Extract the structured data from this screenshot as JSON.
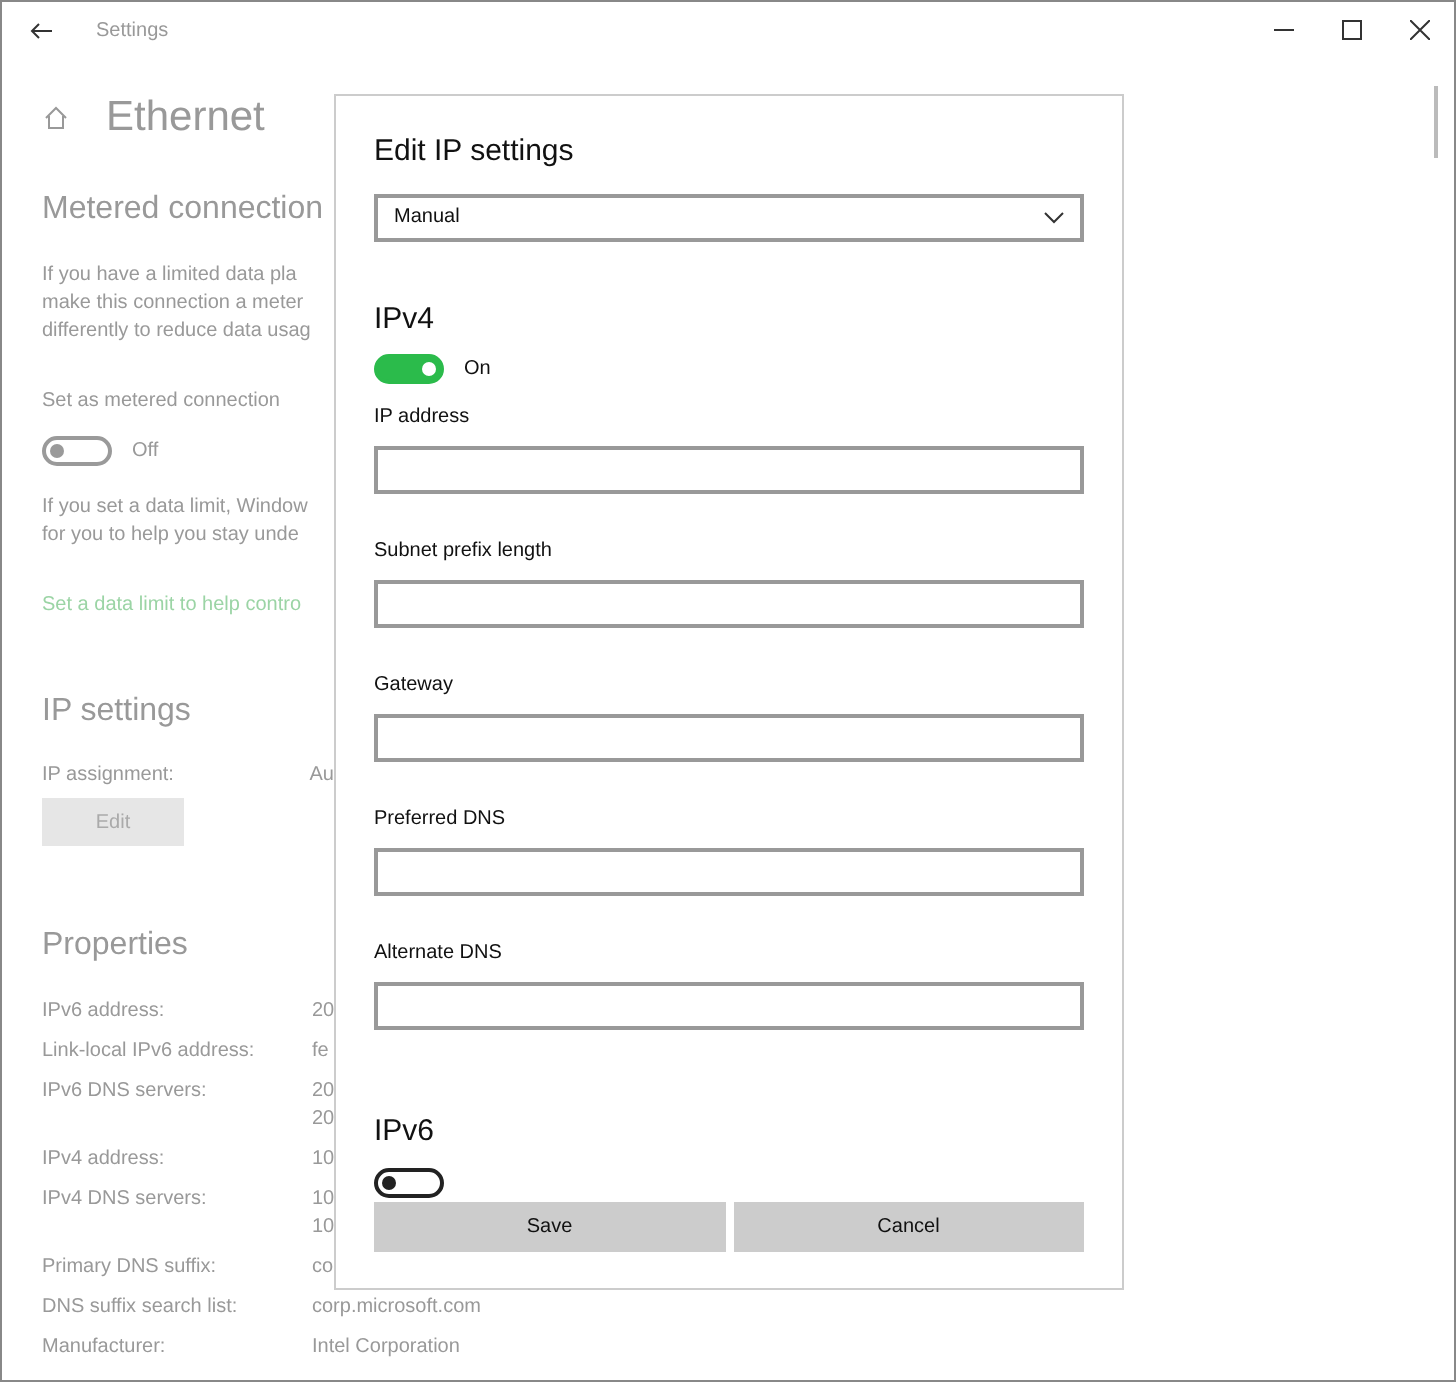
{
  "window": {
    "title": "Settings"
  },
  "page": {
    "title": "Ethernet"
  },
  "metered": {
    "heading": "Metered connection",
    "description": [
      "If you have a limited data pla",
      "make this connection a meter",
      "differently to reduce data usag"
    ],
    "toggle_label": "Set as metered connection",
    "on": false,
    "state_text": "Off",
    "limit_text": [
      "If you set a data limit, Window",
      "for you to help you stay unde"
    ],
    "link": "Set a data limit to help contro"
  },
  "ip_settings": {
    "heading": "IP settings",
    "label": "IP assignment:",
    "value": "Au",
    "button": "Edit"
  },
  "properties": {
    "heading": "Properties",
    "rows": [
      {
        "label": "IPv6 address:",
        "values": [
          "20"
        ]
      },
      {
        "label": "Link-local IPv6 address:",
        "values": [
          "fe"
        ]
      },
      {
        "label": "IPv6 DNS servers:",
        "values": [
          "20",
          "20"
        ]
      },
      {
        "label": "IPv4 address:",
        "values": [
          "10"
        ]
      },
      {
        "label": "IPv4 DNS servers:",
        "values": [
          "10",
          "10"
        ]
      },
      {
        "label": "Primary DNS suffix:",
        "values": [
          "co"
        ]
      },
      {
        "label": "DNS suffix search list:",
        "values": [
          "corp.microsoft.com"
        ]
      },
      {
        "label": "Manufacturer:",
        "values": [
          "Intel Corporation"
        ]
      }
    ]
  },
  "dialog": {
    "title": "Edit IP settings",
    "dropdown": "Manual",
    "ipv4": {
      "heading": "IPv4",
      "on": true,
      "state_text": "On",
      "fields": [
        {
          "label": "IP address"
        },
        {
          "label": "Subnet prefix length"
        },
        {
          "label": "Gateway"
        },
        {
          "label": "Preferred DNS"
        },
        {
          "label": "Alternate DNS"
        }
      ]
    },
    "ipv6": {
      "heading": "IPv6",
      "on": false
    },
    "buttons": [
      "Save",
      "Cancel"
    ]
  }
}
